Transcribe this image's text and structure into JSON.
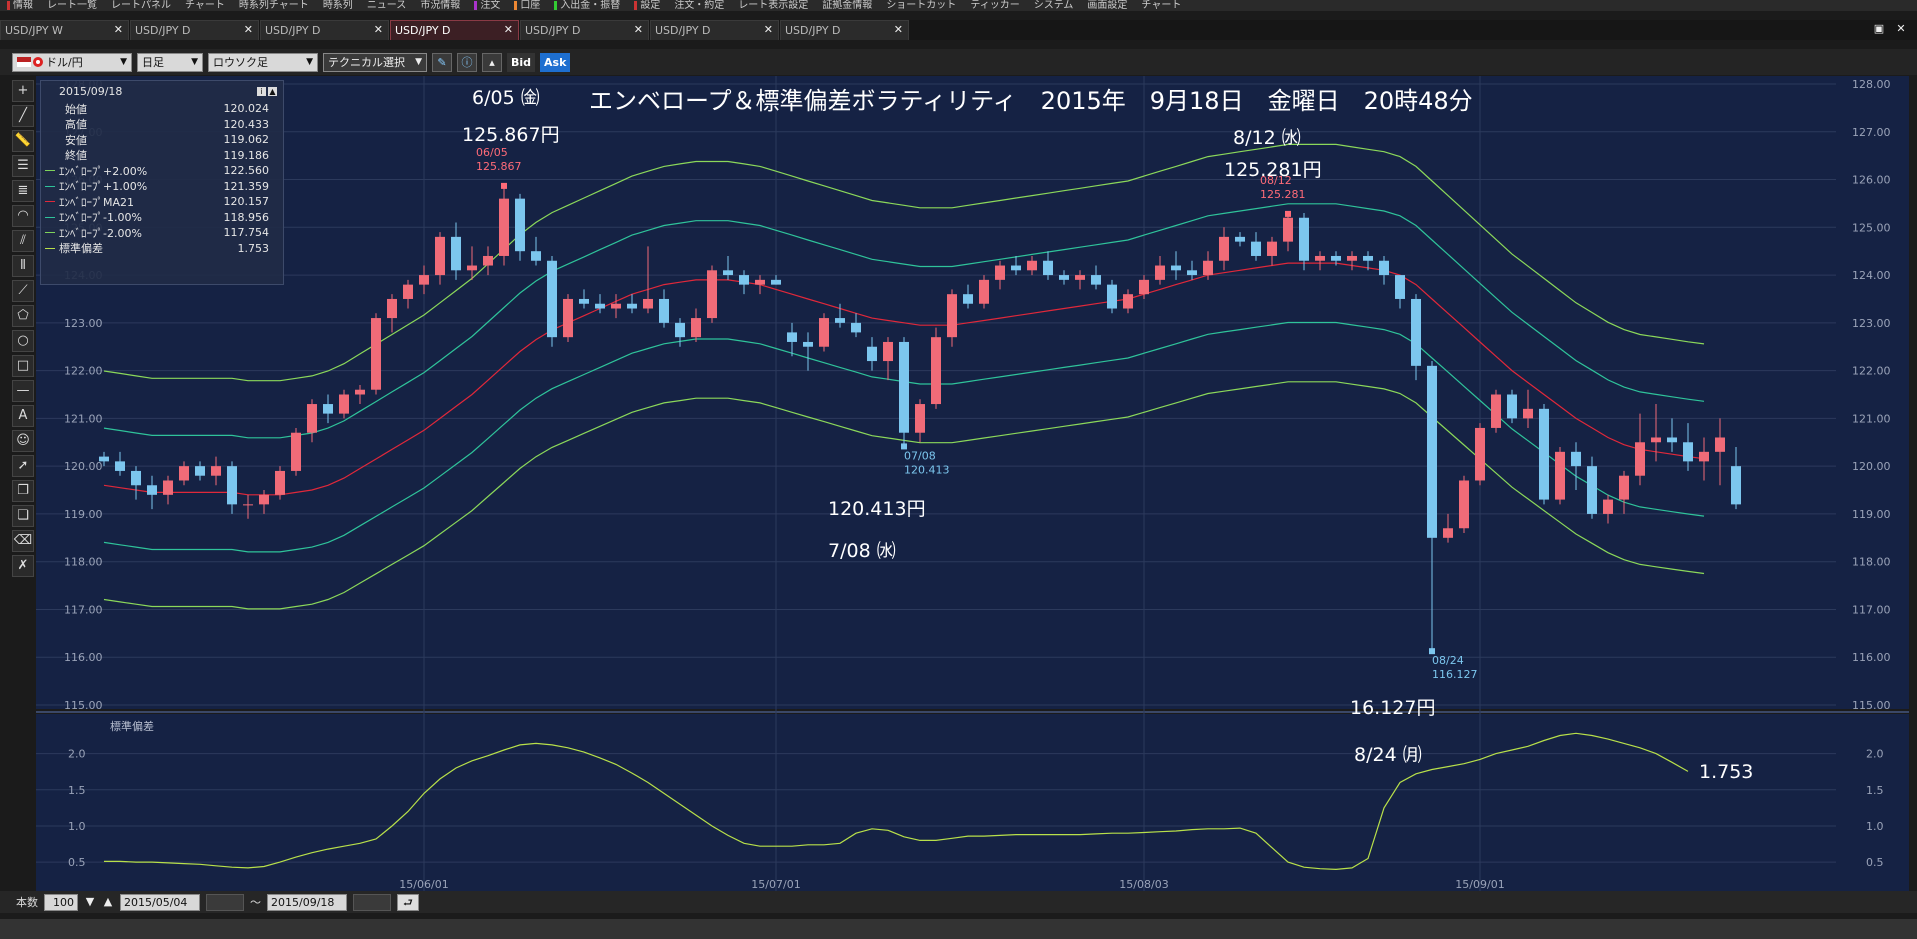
{
  "menu": [
    {
      "label": "情報",
      "color": "#c33"
    },
    {
      "label": "レート一覧",
      "color": ""
    },
    {
      "label": "レートパネル",
      "color": ""
    },
    {
      "label": "チャート",
      "color": ""
    },
    {
      "label": "時系列チャート",
      "color": ""
    },
    {
      "label": "時系列",
      "color": ""
    },
    {
      "label": "ニュース",
      "color": ""
    },
    {
      "label": "市況情報",
      "color": ""
    },
    {
      "label": "注文",
      "color": "#a3c"
    },
    {
      "label": "口座",
      "color": "#e83"
    },
    {
      "label": "入出金・振替",
      "color": "#3c3"
    },
    {
      "label": "設定",
      "color": "#c33"
    },
    {
      "label": "注文・約定",
      "color": ""
    },
    {
      "label": "レート表示設定",
      "color": ""
    },
    {
      "label": "証拠金情報",
      "color": ""
    },
    {
      "label": "ショートカット",
      "color": ""
    },
    {
      "label": "ティッカー",
      "color": ""
    },
    {
      "label": "システム",
      "color": ""
    },
    {
      "label": "画面設定",
      "color": ""
    },
    {
      "label": "チャート",
      "color": ""
    }
  ],
  "tabs": [
    {
      "label": "USD/JPY W",
      "active": false
    },
    {
      "label": "USD/JPY D",
      "active": false
    },
    {
      "label": "USD/JPY D",
      "active": false
    },
    {
      "label": "USD/JPY D",
      "active": true
    },
    {
      "label": "USD/JPY D",
      "active": false
    },
    {
      "label": "USD/JPY D",
      "active": false
    },
    {
      "label": "USD/JPY D",
      "active": false
    }
  ],
  "toolbar": {
    "pair": "ドル/円",
    "period": "日足",
    "chart_type": "ロウソク足",
    "technical": "テクニカル選択",
    "bid": "Bid",
    "ask": "Ask"
  },
  "info": {
    "date": "2015/09/18",
    "rows": [
      {
        "label": "始値",
        "value": "120.024",
        "color": ""
      },
      {
        "label": "高値",
        "value": "120.433",
        "color": ""
      },
      {
        "label": "安値",
        "value": "119.062",
        "color": ""
      },
      {
        "label": "終値",
        "value": "119.186",
        "color": ""
      },
      {
        "label": "ｴﾝﾍﾞﾛｰﾌﾟ+2.00%",
        "value": "122.560",
        "color": "#7fd35b"
      },
      {
        "label": "ｴﾝﾍﾞﾛｰﾌﾟ+1.00%",
        "value": "121.359",
        "color": "#2fc39a"
      },
      {
        "label": "ｴﾝﾍﾞﾛｰﾌﾟMA21",
        "value": "120.157",
        "color": "#e0283a"
      },
      {
        "label": "ｴﾝﾍﾞﾛｰﾌﾟ-1.00%",
        "value": "118.956",
        "color": "#2fc39a"
      },
      {
        "label": "ｴﾝﾍﾞﾛｰﾌﾟ-2.00%",
        "value": "117.754",
        "color": "#7fd35b"
      },
      {
        "label": "標準偏差",
        "value": "1.753",
        "color": "#b8e04a"
      }
    ]
  },
  "annotations": {
    "title": "エンベロープ＆標準偏差ボラティリティ　2015年　9月18日　金曜日　20時48分",
    "high1_date": "6/05 ㈮",
    "high1_price": "125.867円",
    "high2_date": "8/12 ㈬",
    "high2_price": "125.281円",
    "low1_price": "120.413円",
    "low1_date": "7/08 ㈬",
    "low2_price": "16.127円",
    "low2_date": "8/24 ㈪",
    "stdev_value": "1.753",
    "mark_0605": "06/05",
    "mark_0605_v": "125.867",
    "mark_0812": "08/12",
    "mark_0812_v": "125.281",
    "mark_0708": "07/08",
    "mark_0708_v": "120.413",
    "mark_0824": "08/24",
    "mark_0824_v": "116.127"
  },
  "subpanel_label": "標準偏差",
  "bottom": {
    "count_label": "本数",
    "count": "100",
    "from": "2015/05/04",
    "tilde": "～",
    "to": "2015/09/18"
  },
  "chart_data": {
    "type": "candlestick",
    "ylim": [
      115,
      128
    ],
    "yticks": [
      "128.00",
      "127.00",
      "126.00",
      "125.00",
      "124.00",
      "123.00",
      "122.00",
      "121.00",
      "120.00",
      "119.00",
      "118.00",
      "117.00",
      "116.00",
      "115.00"
    ],
    "xticks": [
      {
        "label": "15/06/01",
        "index": 20
      },
      {
        "label": "15/07/01",
        "index": 42
      },
      {
        "label": "15/08/03",
        "index": 65
      },
      {
        "label": "15/09/01",
        "index": 86
      }
    ],
    "candles": [
      [
        120.2,
        120.3,
        120.0,
        120.1
      ],
      [
        120.1,
        120.3,
        119.8,
        119.9
      ],
      [
        119.9,
        120.0,
        119.3,
        119.6
      ],
      [
        119.6,
        119.8,
        119.1,
        119.4
      ],
      [
        119.4,
        119.8,
        119.2,
        119.7
      ],
      [
        119.7,
        120.1,
        119.6,
        120.0
      ],
      [
        120.0,
        120.1,
        119.7,
        119.8
      ],
      [
        119.8,
        120.2,
        119.6,
        120.0
      ],
      [
        120.0,
        120.1,
        119.0,
        119.2
      ],
      [
        119.2,
        119.4,
        118.9,
        119.2
      ],
      [
        119.2,
        119.5,
        119.0,
        119.4
      ],
      [
        119.4,
        120.0,
        119.3,
        119.9
      ],
      [
        119.9,
        120.8,
        119.8,
        120.7
      ],
      [
        120.7,
        121.4,
        120.5,
        121.3
      ],
      [
        121.3,
        121.5,
        120.9,
        121.1
      ],
      [
        121.1,
        121.6,
        121.0,
        121.5
      ],
      [
        121.5,
        121.7,
        121.3,
        121.6
      ],
      [
        121.6,
        123.2,
        121.5,
        123.1
      ],
      [
        123.1,
        123.6,
        122.8,
        123.5
      ],
      [
        123.5,
        123.9,
        123.3,
        123.8
      ],
      [
        123.8,
        124.2,
        123.6,
        124.0
      ],
      [
        124.0,
        124.9,
        123.8,
        124.8
      ],
      [
        124.8,
        125.1,
        123.9,
        124.1
      ],
      [
        124.1,
        124.6,
        123.9,
        124.2
      ],
      [
        124.2,
        124.6,
        124.0,
        124.4
      ],
      [
        124.4,
        125.9,
        124.2,
        125.6
      ],
      [
        125.6,
        125.7,
        124.3,
        124.5
      ],
      [
        124.5,
        124.8,
        124.2,
        124.3
      ],
      [
        124.3,
        124.4,
        122.5,
        122.7
      ],
      [
        122.7,
        123.6,
        122.6,
        123.5
      ],
      [
        123.5,
        123.7,
        123.3,
        123.4
      ],
      [
        123.4,
        123.6,
        123.2,
        123.3
      ],
      [
        123.3,
        123.6,
        123.1,
        123.4
      ],
      [
        123.4,
        123.6,
        123.2,
        123.3
      ],
      [
        123.3,
        124.6,
        123.2,
        123.5
      ],
      [
        123.5,
        123.7,
        122.9,
        123.0
      ],
      [
        123.0,
        123.1,
        122.5,
        122.7
      ],
      [
        122.7,
        123.3,
        122.6,
        123.1
      ],
      [
        123.1,
        124.2,
        123.0,
        124.1
      ],
      [
        124.1,
        124.4,
        123.9,
        124.0
      ],
      [
        124.0,
        124.1,
        123.6,
        123.8
      ],
      [
        123.8,
        124.0,
        123.6,
        123.9
      ],
      [
        123.9,
        124.0,
        123.8,
        123.8
      ],
      [
        122.8,
        123.0,
        122.3,
        122.6
      ],
      [
        122.6,
        122.8,
        122.0,
        122.5
      ],
      [
        122.5,
        123.2,
        122.4,
        123.1
      ],
      [
        123.1,
        123.4,
        122.9,
        123.0
      ],
      [
        123.0,
        123.2,
        122.7,
        122.8
      ],
      [
        122.5,
        122.7,
        122.0,
        122.2
      ],
      [
        122.2,
        122.7,
        121.8,
        122.6
      ],
      [
        122.6,
        122.7,
        120.4,
        120.7
      ],
      [
        120.7,
        121.4,
        120.5,
        121.3
      ],
      [
        121.3,
        122.9,
        121.2,
        122.7
      ],
      [
        122.7,
        123.7,
        122.5,
        123.6
      ],
      [
        123.6,
        123.8,
        123.3,
        123.4
      ],
      [
        123.4,
        124.0,
        123.3,
        123.9
      ],
      [
        123.9,
        124.3,
        123.7,
        124.2
      ],
      [
        124.2,
        124.4,
        124.0,
        124.1
      ],
      [
        124.1,
        124.4,
        124.0,
        124.3
      ],
      [
        124.3,
        124.5,
        123.9,
        124.0
      ],
      [
        124.0,
        124.1,
        123.8,
        123.9
      ],
      [
        123.9,
        124.1,
        123.7,
        124.0
      ],
      [
        124.0,
        124.2,
        123.7,
        123.8
      ],
      [
        123.8,
        123.9,
        123.2,
        123.3
      ],
      [
        123.3,
        123.7,
        123.2,
        123.6
      ],
      [
        123.6,
        124.0,
        123.5,
        123.9
      ],
      [
        123.9,
        124.4,
        123.8,
        124.2
      ],
      [
        124.2,
        124.5,
        123.9,
        124.1
      ],
      [
        124.1,
        124.3,
        123.9,
        124.0
      ],
      [
        124.0,
        124.5,
        123.9,
        124.3
      ],
      [
        124.3,
        125.0,
        124.1,
        124.8
      ],
      [
        124.8,
        124.9,
        124.6,
        124.7
      ],
      [
        124.7,
        124.9,
        124.3,
        124.4
      ],
      [
        124.4,
        124.8,
        124.2,
        124.7
      ],
      [
        124.7,
        125.3,
        124.5,
        125.2
      ],
      [
        125.2,
        125.3,
        124.1,
        124.3
      ],
      [
        124.3,
        124.5,
        124.1,
        124.4
      ],
      [
        124.4,
        124.5,
        124.2,
        124.3
      ],
      [
        124.3,
        124.5,
        124.1,
        124.4
      ],
      [
        124.4,
        124.5,
        124.1,
        124.3
      ],
      [
        124.3,
        124.4,
        123.8,
        124.0
      ],
      [
        124.0,
        124.0,
        123.3,
        123.5
      ],
      [
        123.5,
        123.6,
        121.8,
        122.1
      ],
      [
        122.1,
        122.2,
        116.1,
        118.5
      ],
      [
        118.5,
        119.0,
        118.4,
        118.7
      ],
      [
        118.7,
        119.8,
        118.6,
        119.7
      ],
      [
        119.7,
        120.9,
        119.6,
        120.8
      ],
      [
        120.8,
        121.6,
        120.7,
        121.5
      ],
      [
        121.5,
        121.6,
        120.9,
        121.0
      ],
      [
        121.0,
        121.6,
        120.8,
        121.2
      ],
      [
        121.2,
        121.3,
        119.2,
        119.3
      ],
      [
        119.3,
        120.4,
        119.2,
        120.3
      ],
      [
        120.3,
        120.5,
        119.5,
        120.0
      ],
      [
        120.0,
        120.2,
        118.9,
        119.0
      ],
      [
        119.0,
        119.4,
        118.8,
        119.3
      ],
      [
        119.3,
        119.9,
        119.0,
        119.8
      ],
      [
        119.8,
        121.1,
        119.6,
        120.5
      ],
      [
        120.5,
        121.3,
        120.1,
        120.6
      ],
      [
        120.6,
        121.0,
        120.3,
        120.5
      ],
      [
        120.5,
        120.9,
        119.9,
        120.1
      ],
      [
        120.1,
        120.6,
        119.7,
        120.3
      ],
      [
        120.3,
        121.0,
        119.6,
        120.6
      ],
      [
        120.0,
        120.4,
        119.1,
        119.2
      ]
    ],
    "ma21": [
      119.6,
      119.55,
      119.5,
      119.45,
      119.45,
      119.45,
      119.45,
      119.45,
      119.45,
      119.4,
      119.4,
      119.4,
      119.45,
      119.5,
      119.6,
      119.75,
      119.95,
      120.15,
      120.35,
      120.55,
      120.75,
      121.0,
      121.25,
      121.5,
      121.8,
      122.1,
      122.4,
      122.65,
      122.85,
      123.0,
      123.15,
      123.3,
      123.45,
      123.6,
      123.7,
      123.8,
      123.85,
      123.9,
      123.9,
      123.9,
      123.85,
      123.8,
      123.7,
      123.6,
      123.5,
      123.4,
      123.3,
      123.2,
      123.1,
      123.05,
      123.0,
      122.95,
      122.95,
      122.95,
      123.0,
      123.05,
      123.1,
      123.15,
      123.2,
      123.25,
      123.3,
      123.35,
      123.4,
      123.45,
      123.5,
      123.6,
      123.7,
      123.8,
      123.9,
      124.0,
      124.05,
      124.1,
      124.15,
      124.2,
      124.25,
      124.25,
      124.25,
      124.25,
      124.2,
      124.15,
      124.1,
      124.0,
      123.8,
      123.5,
      123.2,
      122.9,
      122.6,
      122.3,
      122.0,
      121.75,
      121.5,
      121.25,
      121.0,
      120.8,
      120.6,
      120.45,
      120.35,
      120.3,
      120.25,
      120.2,
      120.157
    ],
    "stdev": [
      0.51,
      0.51,
      0.5,
      0.5,
      0.49,
      0.48,
      0.47,
      0.45,
      0.43,
      0.42,
      0.44,
      0.5,
      0.57,
      0.63,
      0.68,
      0.72,
      0.76,
      0.82,
      1.0,
      1.2,
      1.45,
      1.65,
      1.8,
      1.9,
      1.97,
      2.05,
      2.12,
      2.14,
      2.12,
      2.08,
      2.02,
      1.94,
      1.85,
      1.73,
      1.6,
      1.45,
      1.3,
      1.15,
      1.0,
      0.87,
      0.76,
      0.72,
      0.72,
      0.72,
      0.74,
      0.74,
      0.76,
      0.9,
      0.96,
      0.94,
      0.85,
      0.8,
      0.8,
      0.83,
      0.86,
      0.86,
      0.87,
      0.88,
      0.88,
      0.88,
      0.88,
      0.88,
      0.89,
      0.9,
      0.9,
      0.91,
      0.92,
      0.93,
      0.95,
      0.96,
      0.96,
      0.97,
      0.9,
      0.7,
      0.5,
      0.43,
      0.41,
      0.4,
      0.42,
      0.55,
      1.25,
      1.6,
      1.72,
      1.78,
      1.82,
      1.86,
      1.92,
      2.0,
      2.05,
      2.1,
      2.18,
      2.25,
      2.28,
      2.25,
      2.2,
      2.14,
      2.08,
      2.0,
      1.88,
      1.753
    ],
    "stdev_ylim": [
      0.35,
      2.45
    ],
    "stdev_yticks": [
      "2.0",
      "1.5",
      "1.0",
      "0.5"
    ]
  },
  "colors": {
    "bg": "#152244",
    "grid": "#2c3a5c",
    "up": "#f06b78",
    "down": "#7cc6ee",
    "ma": "#e0283a",
    "env1": "#2fc39a",
    "env2": "#8bd85a",
    "stdev": "#b8e04a",
    "highlabel": "#ff6b78",
    "lowlabel": "#7cc6ee"
  }
}
